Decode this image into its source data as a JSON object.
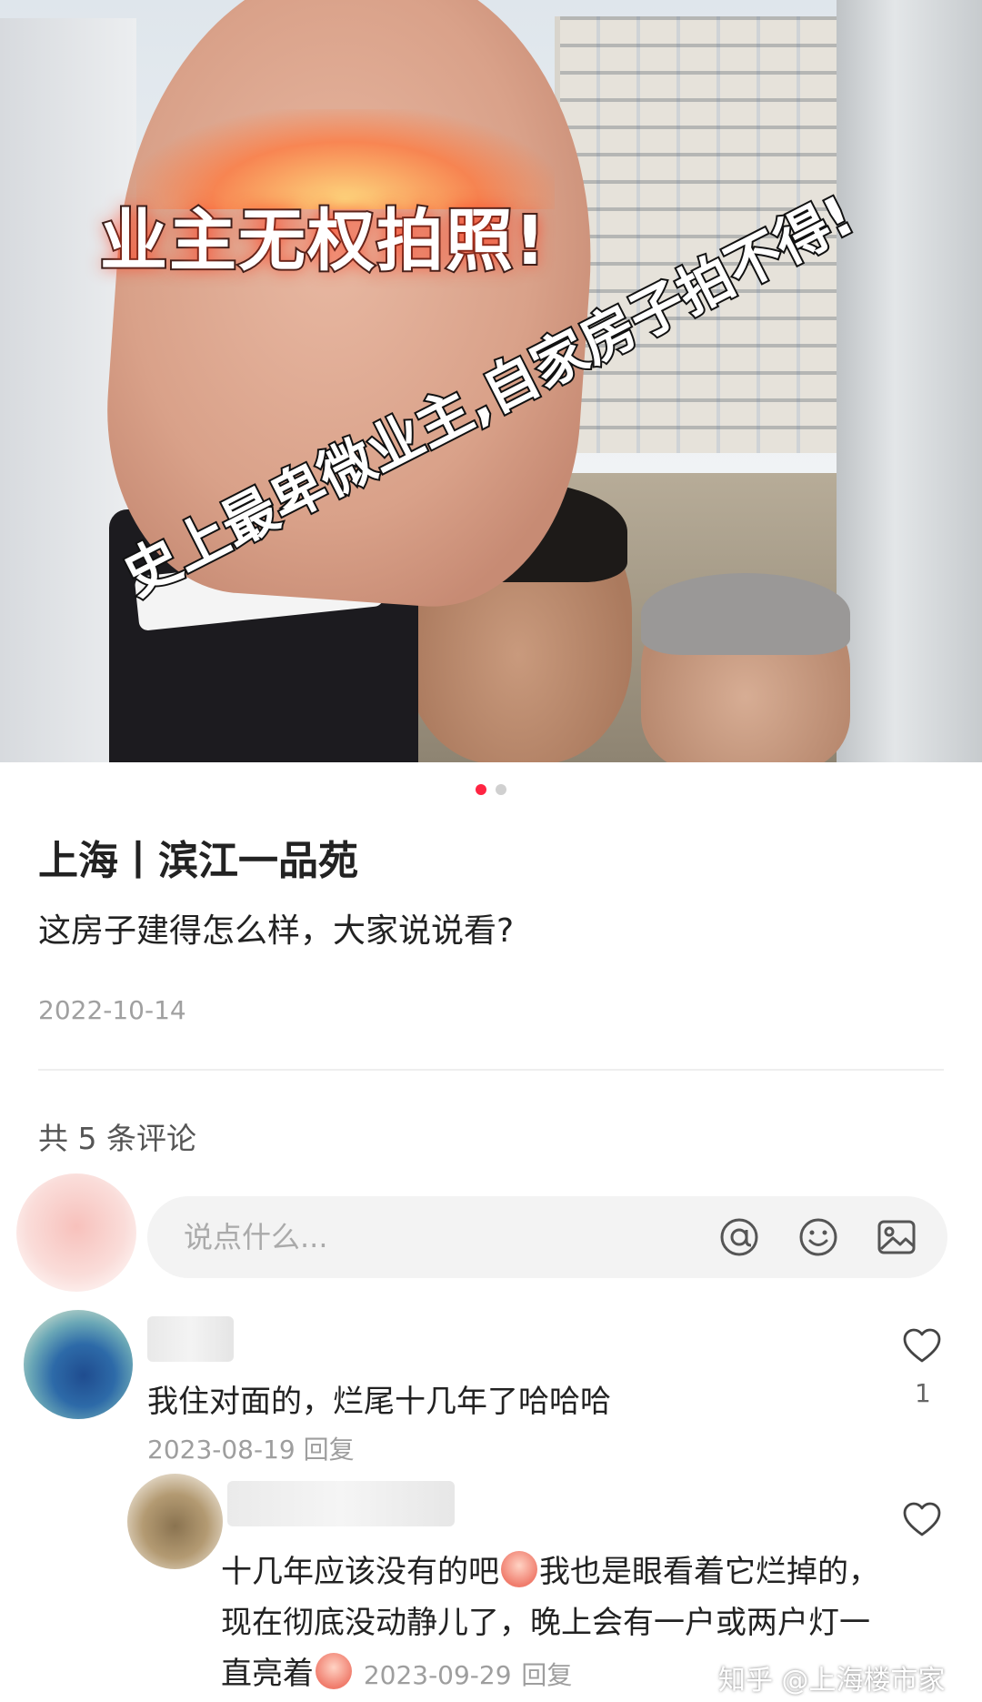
{
  "hero": {
    "overlay_text_1": "业主无权拍照!",
    "overlay_text_2": "史上最卑微业主,自家房子拍不得!",
    "pager": {
      "count": 2,
      "active_index": 0
    }
  },
  "post": {
    "title": "上海丨滨江一品苑",
    "body": "这房子建得怎么样，大家说说看?",
    "date": "2022-10-14"
  },
  "comments_header": {
    "count_label": "共 5 条评论"
  },
  "comment_input": {
    "placeholder": "说点什么...",
    "icons": [
      "at-icon",
      "emoji-icon",
      "image-icon"
    ]
  },
  "comments": [
    {
      "text": "我住对面的，烂尾十几年了哈哈哈",
      "date": "2023-08-19",
      "reply_label": "回复",
      "likes": "1"
    },
    {
      "text_part1": "十几年应该没有的吧",
      "text_part2": "我也是眼看着它烂掉的，现在彻底没动静儿了，晚上会有一户或两户灯一直亮着",
      "date": "2023-09-29",
      "reply_label": "回复"
    }
  ],
  "watermark": "知乎 @上海楼市家",
  "colors": {
    "accent": "#ff2442",
    "muted": "#9e9e9e",
    "text": "#222222"
  }
}
